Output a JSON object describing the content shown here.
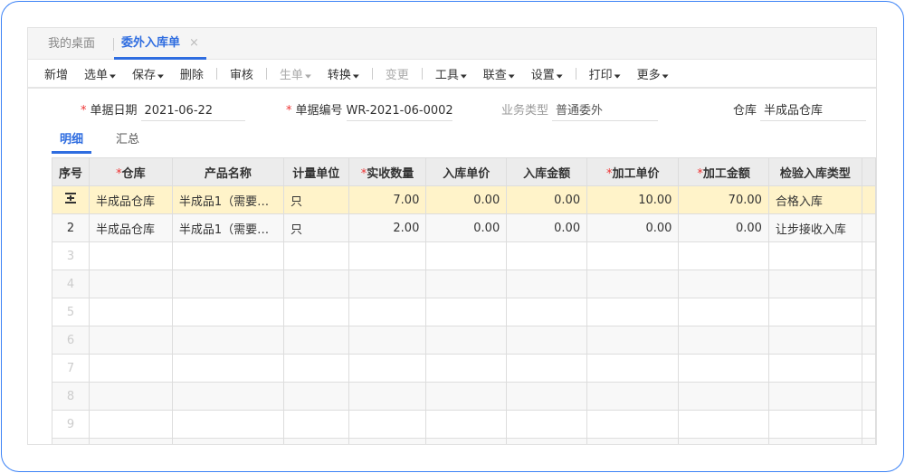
{
  "tabs": [
    {
      "label": "我的桌面",
      "active": false
    },
    {
      "label": "委外入库单",
      "active": true,
      "close": "×"
    }
  ],
  "toolbar": [
    {
      "label": "新增",
      "dropdown": false,
      "disabled": false
    },
    {
      "label": "选单",
      "dropdown": true,
      "disabled": false
    },
    {
      "label": "保存",
      "dropdown": true,
      "disabled": false
    },
    {
      "label": "删除",
      "dropdown": false,
      "disabled": false
    },
    {
      "label": "审核",
      "dropdown": false,
      "disabled": false
    },
    {
      "label": "生单",
      "dropdown": true,
      "disabled": true
    },
    {
      "label": "转换",
      "dropdown": true,
      "disabled": false
    },
    {
      "label": "变更",
      "dropdown": false,
      "disabled": true
    },
    {
      "label": "工具",
      "dropdown": true,
      "disabled": false
    },
    {
      "label": "联查",
      "dropdown": true,
      "disabled": false
    },
    {
      "label": "设置",
      "dropdown": true,
      "disabled": false
    },
    {
      "label": "打印",
      "dropdown": true,
      "disabled": false
    },
    {
      "label": "更多",
      "dropdown": true,
      "disabled": false
    }
  ],
  "form": {
    "date_label": "单据日期",
    "date_value": "2021-06-22",
    "number_label": "单据编号",
    "number_value": "WR-2021-06-0002",
    "type_label": "业务类型",
    "type_value": "普通委外",
    "warehouse_label": "仓库",
    "warehouse_value": "半成品仓库"
  },
  "subtabs": [
    {
      "label": "明细",
      "active": true
    },
    {
      "label": "汇总",
      "active": false
    }
  ],
  "table": {
    "columns": [
      {
        "label": "序号",
        "required": false
      },
      {
        "label": "仓库",
        "required": true
      },
      {
        "label": "产品名称",
        "required": false
      },
      {
        "label": "计量单位",
        "required": false
      },
      {
        "label": "实收数量",
        "required": true
      },
      {
        "label": "入库单价",
        "required": false
      },
      {
        "label": "入库金额",
        "required": false
      },
      {
        "label": "加工单价",
        "required": true
      },
      {
        "label": "加工金额",
        "required": true
      },
      {
        "label": "检验入库类型",
        "required": false
      }
    ],
    "rows": [
      {
        "seq": "insert-row-icon",
        "cells": [
          "半成品仓库",
          "半成品1（需要…",
          "只",
          "7.00",
          "0.00",
          "0.00",
          "10.00",
          "70.00",
          "合格入库"
        ]
      },
      {
        "seq": "2",
        "cells": [
          "半成品仓库",
          "半成品1（需要…",
          "只",
          "2.00",
          "0.00",
          "0.00",
          "0.00",
          "0.00",
          "让步接收入库"
        ]
      }
    ],
    "empty_rows": [
      "3",
      "4",
      "5",
      "6",
      "7",
      "8",
      "9"
    ]
  }
}
